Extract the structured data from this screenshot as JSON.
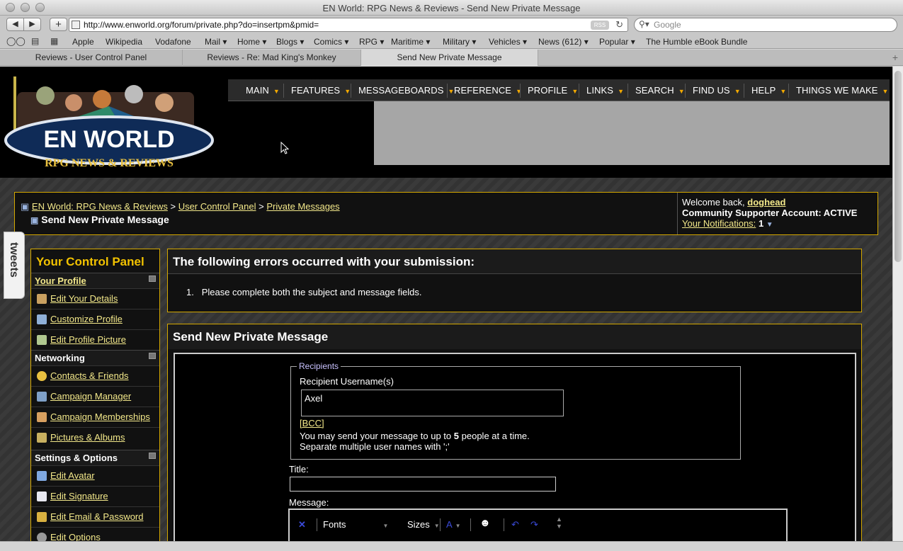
{
  "window": {
    "title": "EN World: RPG News & Reviews - Send New Private Message"
  },
  "browser": {
    "url": "http://www.enworld.org/forum/private.php?do=insertpm&pmid=",
    "rss_label": "RSS",
    "search_placeholder": "Google",
    "bookmarks": [
      "Apple",
      "Wikipedia",
      "Vodafone",
      "Mail ▾",
      "Home ▾",
      "Blogs ▾",
      "Comics ▾",
      "RPG ▾",
      "Maritime ▾",
      "Military ▾",
      "Vehicles ▾",
      "News (612) ▾",
      "Popular ▾",
      "The Humble eBook Bundle"
    ],
    "tabs": [
      "Reviews - User Control Panel",
      "Reviews - Re: Mad King's Monkey",
      "Send New Private Message"
    ]
  },
  "site": {
    "logo_text": "EN WORLD",
    "logo_sub": "RPG NEWS & REVIEWS",
    "menu": [
      "MAIN",
      "FEATURES",
      "MESSAGEBOARDS",
      "REFERENCE",
      "PROFILE",
      "LINKS",
      "SEARCH",
      "FIND US",
      "HELP",
      "THINGS WE MAKE"
    ]
  },
  "breadcrumb": {
    "items": [
      "EN World: RPG News & Reviews",
      "User Control Panel",
      "Private Messages"
    ],
    "separator": ">",
    "current": "Send New Private Message"
  },
  "welcome": {
    "greeting": "Welcome back,",
    "username": "doghead",
    "account": "Community Supporter Account: ACTIVE",
    "notifications_label": "Your Notifications:",
    "notifications_count": "1"
  },
  "tweets_label": "tweets",
  "control_panel": {
    "title": "Your Control Panel",
    "sections": [
      {
        "label": "Your Profile",
        "items": [
          "Edit Your Details",
          "Customize Profile",
          "Edit Profile Picture"
        ]
      },
      {
        "label": "Networking",
        "items": [
          "Contacts & Friends",
          "Campaign Manager",
          "Campaign Memberships",
          "Pictures & Albums"
        ]
      },
      {
        "label": "Settings & Options",
        "items": [
          "Edit Avatar",
          "Edit Signature",
          "Edit Email & Password",
          "Edit Options"
        ]
      }
    ]
  },
  "errors": {
    "heading": "The following errors occurred with your submission:",
    "items": [
      "Please complete both the subject and message fields."
    ]
  },
  "pm_form": {
    "heading": "Send New Private Message",
    "recipients_legend": "Recipients",
    "recipient_label": "Recipient Username(s)",
    "recipient_value": "Axel",
    "bcc_label": "[BCC]",
    "note_line1_pre": "You may send your message to up to",
    "note_line1_num": "5",
    "note_line1_post": "people at a time.",
    "note_line2": "Separate multiple user names with ';'",
    "title_label": "Title:",
    "title_value": "",
    "message_label": "Message:",
    "editor": {
      "fonts": "Fonts",
      "sizes": "Sizes"
    }
  },
  "colors": {
    "accent": "#d4a800",
    "link": "#f3e88a",
    "menu_arrow": "#f2a900",
    "heading_gold": "#f2c200"
  }
}
